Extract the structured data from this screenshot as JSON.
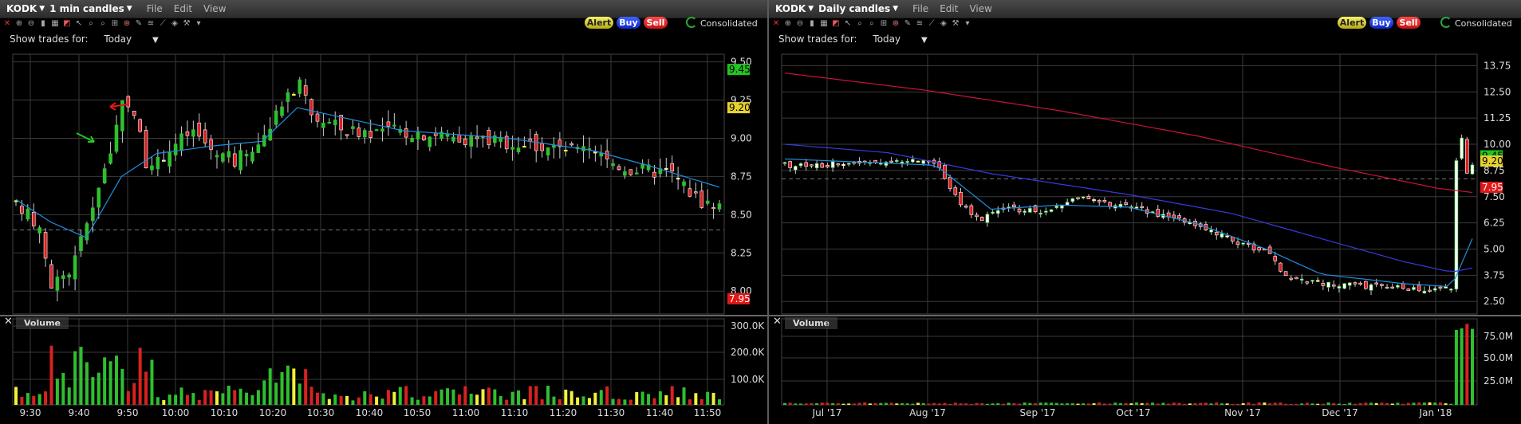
{
  "left": {
    "ticker": "KODK",
    "period": "1 min candles",
    "menus": [
      "File",
      "Edit",
      "View"
    ],
    "buttons": {
      "alert": "Alert",
      "buy": "Buy",
      "sell": "Sell"
    },
    "consolidated": "Consolidated",
    "show_trades_label": "Show trades for:",
    "show_trades_value": "Today",
    "price_ticks": [
      "9.50",
      "9.25",
      "9.00",
      "8.75",
      "8.50",
      "8.25",
      "8.00"
    ],
    "volume_ticks": [
      "300.0K",
      "200.0K",
      "100.0K"
    ],
    "time_ticks": [
      "9:30",
      "9:40",
      "9:50",
      "10:00",
      "10:10",
      "10:20",
      "10:30",
      "10:40",
      "10:50",
      "11:00",
      "11:10",
      "11:20",
      "11:30",
      "11:40",
      "11:50"
    ],
    "badges": {
      "high": "9.45",
      "last": "9.20",
      "low": "7.95"
    },
    "volume_label": "Volume"
  },
  "right": {
    "ticker": "KODK",
    "period": "Daily candles",
    "menus": [
      "File",
      "Edit",
      "View"
    ],
    "buttons": {
      "alert": "Alert",
      "buy": "Buy",
      "sell": "Sell"
    },
    "consolidated": "Consolidated",
    "show_trades_label": "Show trades for:",
    "show_trades_value": "Today",
    "price_ticks": [
      "13.75",
      "12.50",
      "11.25",
      "10.00",
      "8.75",
      "7.50",
      "6.25",
      "5.00",
      "3.75",
      "2.50"
    ],
    "volume_ticks": [
      "75.0M",
      "50.0M",
      "25.0M"
    ],
    "time_ticks": [
      "Jul '17",
      "Aug '17",
      "Sep '17",
      "Oct '17",
      "Nov '17",
      "Dec '17",
      "Jan '18"
    ],
    "badges": {
      "high": "9.45",
      "last": "9.20",
      "low": "7.95"
    },
    "volume_label": "Volume"
  },
  "colors": {
    "up": "#2fbf2f",
    "down": "#d92121",
    "neutral": "#f2f23a",
    "ma_short": "#1e8fe0",
    "ma_long": "#3a3adc",
    "ma_red": "#c8143c"
  },
  "chart_data": [
    {
      "type": "candlestick",
      "title": "KODK 1 min candles",
      "ylim": [
        7.85,
        9.55
      ],
      "x_range": [
        "9:30",
        "11:52"
      ],
      "series": [
        {
          "name": "price_close_approx",
          "x": [
            "9:30",
            "9:35",
            "9:40",
            "9:45",
            "9:48",
            "9:50",
            "9:55",
            "10:00",
            "10:05",
            "10:10",
            "10:15",
            "10:20",
            "10:25",
            "10:30",
            "10:40",
            "10:50",
            "11:00",
            "11:10",
            "11:20",
            "11:30",
            "11:40",
            "11:50"
          ],
          "values": [
            8.55,
            8.05,
            8.45,
            8.95,
            9.25,
            8.85,
            8.95,
            9.05,
            8.9,
            8.85,
            9.05,
            9.3,
            9.35,
            9.15,
            9.1,
            9.05,
            9.02,
            8.95,
            8.95,
            8.85,
            8.78,
            8.55
          ]
        },
        {
          "name": "volume",
          "values": [
            80,
            160,
            120,
            200,
            280,
            180,
            140,
            110,
            90,
            120,
            160,
            230,
            170,
            130,
            90,
            60,
            40,
            50,
            40,
            50,
            60,
            80
          ]
        }
      ]
    },
    {
      "type": "candlestick",
      "title": "KODK Daily candles",
      "ylim": [
        1.9,
        14.3
      ],
      "x_range": [
        "Jun '17",
        "Jan '18"
      ],
      "series": [
        {
          "name": "price_close_approx",
          "x": [
            "Jul '17",
            "Aug '17",
            "Aug mid",
            "Sep '17",
            "Sep mid",
            "Oct '17",
            "Nov '17",
            "Nov mid",
            "Dec '17",
            "Jan '18",
            "Jan spike"
          ],
          "values": [
            9.0,
            9.2,
            6.5,
            6.9,
            7.5,
            6.8,
            5.1,
            3.5,
            3.3,
            3.1,
            9.2
          ]
        },
        {
          "name": "volume_millions",
          "values": [
            0,
            0,
            1,
            1,
            2,
            1,
            2,
            2,
            1,
            1,
            95
          ]
        }
      ]
    }
  ]
}
